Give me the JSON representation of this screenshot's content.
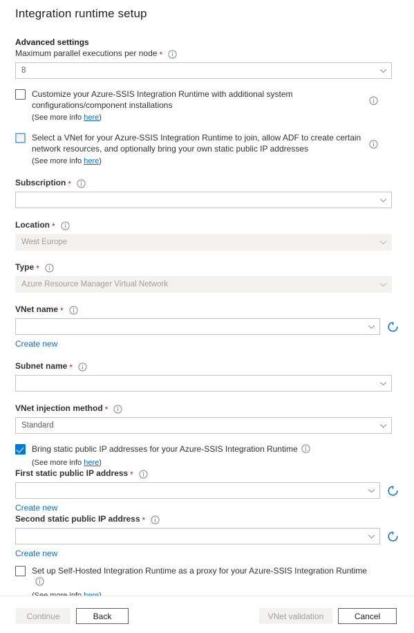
{
  "page": {
    "title": "Integration runtime setup",
    "section_heading": "Advanced settings"
  },
  "icons": {
    "info": "info-icon",
    "chevron": "chevron-down-icon",
    "refresh": "refresh-icon"
  },
  "colors": {
    "accent": "#0078d4",
    "link": "#0f6cbd",
    "required": "#a4262c",
    "disabled_bg": "#f3f2f1",
    "disabled_text": "#a19f9d",
    "border": "#c8c6c4"
  },
  "fields": {
    "max_parallel": {
      "label": "Maximum parallel executions per node",
      "required": "*",
      "value": "8"
    },
    "subscription": {
      "label": "Subscription",
      "required": "*",
      "value": ""
    },
    "location": {
      "label": "Location",
      "required": "*",
      "value": "West Europe"
    },
    "type": {
      "label": "Type",
      "required": "*",
      "value": "Azure Resource Manager Virtual Network"
    },
    "vnet_name": {
      "label": "VNet name",
      "required": "*",
      "value": "",
      "create_new": "Create new"
    },
    "subnet_name": {
      "label": "Subnet name",
      "required": "*",
      "value": ""
    },
    "vnet_injection_method": {
      "label": "VNet injection method",
      "required": "*",
      "value": "Standard"
    },
    "first_ip": {
      "label": "First static public IP address",
      "required": "*",
      "value": "",
      "create_new": "Create new"
    },
    "second_ip": {
      "label": "Second static public IP address",
      "required": "*",
      "value": "",
      "create_new": "Create new"
    }
  },
  "checkboxes": {
    "customize": {
      "label": "Customize your Azure-SSIS Integration Runtime with additional system configurations/component installations",
      "checked": false,
      "hint_prefix": "(See more info ",
      "hint_link": "here",
      "hint_suffix": ")"
    },
    "select_vnet": {
      "label": "Select a VNet for your Azure-SSIS Integration Runtime to join, allow ADF to create certain network resources, and optionally bring your own static public IP addresses",
      "checked": true,
      "hint_prefix": "(See more info ",
      "hint_link": "here",
      "hint_suffix": ")"
    },
    "bring_static_ip": {
      "label": "Bring static public IP addresses for your Azure-SSIS Integration Runtime",
      "checked": true,
      "hint_prefix": "(See more info ",
      "hint_link": "here",
      "hint_suffix": ")"
    },
    "self_hosted_proxy": {
      "label": "Set up Self-Hosted Integration Runtime as a proxy for your Azure-SSIS Integration Runtime",
      "checked": false,
      "hint_prefix": "(See more info ",
      "hint_link": "here",
      "hint_suffix": ")"
    }
  },
  "footer": {
    "continue": "Continue",
    "back": "Back",
    "vnet_validation": "VNet validation",
    "cancel": "Cancel"
  }
}
